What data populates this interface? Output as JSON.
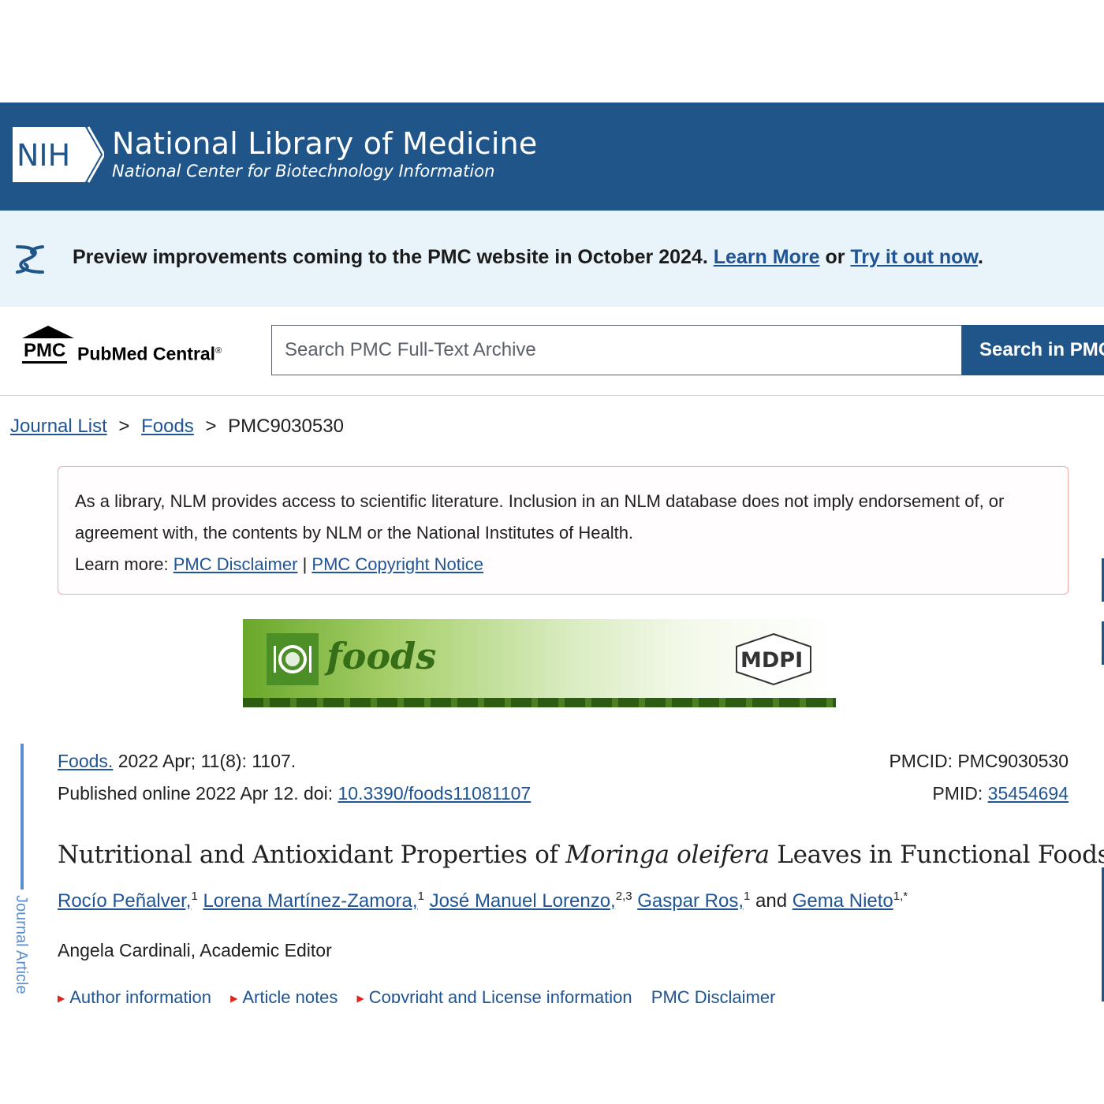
{
  "header": {
    "logo_text": "NIH",
    "title": "National Library of Medicine",
    "subtitle": "National Center for Biotechnology Information"
  },
  "preview_banner": {
    "text": "Preview improvements coming to the PMC website in October 2024.",
    "learn_more": "Learn More",
    "or": "or",
    "try_it": "Try it out now",
    "period": "."
  },
  "pmc_bar": {
    "logo_mark": "PMC",
    "logo_name": "PubMed Central",
    "logo_reg": "®",
    "search_placeholder": "Search PMC Full-Text Archive",
    "search_button": "Search in PMC"
  },
  "breadcrumb": {
    "items": [
      "Journal List",
      "Foods",
      "PMC9030530"
    ],
    "separator": ">"
  },
  "disclaimer": {
    "line1": "As a library, NLM provides access to scientific literature. Inclusion in an NLM database does not imply endorsement of, or agreement with, the contents by NLM or the National Institutes of Health.",
    "learn_more_label": "Learn more:",
    "link1": "PMC Disclaimer",
    "divider": "|",
    "link2": "PMC Copyright Notice"
  },
  "journal_banner": {
    "journal": "foods",
    "publisher": "MDPI"
  },
  "rail_label": "Journal Article",
  "citation": {
    "journal_link": "Foods.",
    "issue": "2022 Apr; 11(8): 1107.",
    "published": "Published online 2022 Apr 12. doi:",
    "doi": "10.3390/foods11081107",
    "pmcid_label": "PMCID:",
    "pmcid": "PMC9030530",
    "pmid_label": "PMID:",
    "pmid": "35454694"
  },
  "article": {
    "title_pre": "Nutritional and Antioxidant Properties of ",
    "title_italic": "Moringa oleifera",
    "title_post": " Leaves in Functional Foods",
    "authors": [
      {
        "name": "Rocío Peñalver,",
        "sup": "1"
      },
      {
        "name": "Lorena Martínez-Zamora,",
        "sup": "1"
      },
      {
        "name": "José Manuel Lorenzo,",
        "sup": "2,3"
      },
      {
        "name": "Gaspar Ros,",
        "sup": "1"
      },
      {
        "name": "Gema Nieto",
        "sup": "1,*"
      }
    ],
    "and": "and",
    "editor": "Angela Cardinali, Academic Editor"
  },
  "meta_links": [
    "Author information",
    "Article notes",
    "Copyright and License information",
    "PMC Disclaimer"
  ],
  "colors": {
    "nih_blue": "#20558a",
    "banner_bg": "#e8f3fa",
    "link": "#205493",
    "disclaimer_border": "#f0a9a4"
  }
}
